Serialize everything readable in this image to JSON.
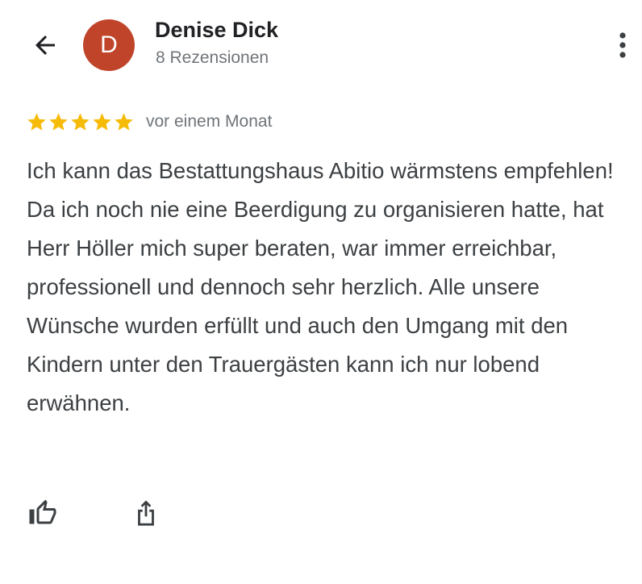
{
  "header": {
    "back_icon": "arrow-left-icon",
    "avatar_letter": "D",
    "avatar_color": "#c0442a",
    "reviewer_name": "Denise Dick",
    "review_count": "8 Rezensionen",
    "more_icon": "more-vert-icon"
  },
  "review": {
    "rating": 5,
    "rating_max": 5,
    "star_color": "#f6bb06",
    "time": "vor einem Monat",
    "text": "Ich kann das Bestattungshaus Abitio wärmstens empfehlen!\nDa ich noch nie eine Beerdigung zu organisieren hatte, hat Herr Höller mich super beraten, war immer erreichbar, professionell und dennoch sehr herzlich. Alle unsere Wünsche wurden erfüllt und auch den Umgang mit den Kindern unter den Trauergästen kann ich nur lobend erwähnen."
  },
  "actions": {
    "like_icon": "thumbs-up-icon",
    "share_icon": "share-icon"
  }
}
